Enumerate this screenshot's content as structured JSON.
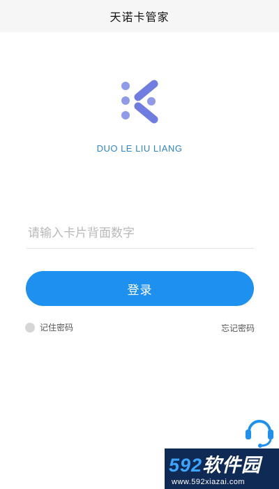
{
  "header": {
    "title": "天诺卡管家"
  },
  "logo": {
    "icon": "k-logo-icon",
    "brand_text": "DUO LE LIU LIANG",
    "colors": {
      "dots": "#8f9be8",
      "bars": "#6f7ce0"
    }
  },
  "login_form": {
    "card_input": {
      "placeholder": "请输入卡片背面数字",
      "value": ""
    },
    "login_button": {
      "label": "登录",
      "color": "#1e90f0"
    },
    "remember_password": {
      "label": "记住密码",
      "checked": false
    },
    "forgot_password": {
      "label": "忘记密码"
    }
  },
  "support": {
    "icon": "headset-icon",
    "color": "#1e90f0"
  },
  "watermark": {
    "brand_num": "592",
    "brand_text": "软件园",
    "url": "www.592xiazai.com"
  }
}
